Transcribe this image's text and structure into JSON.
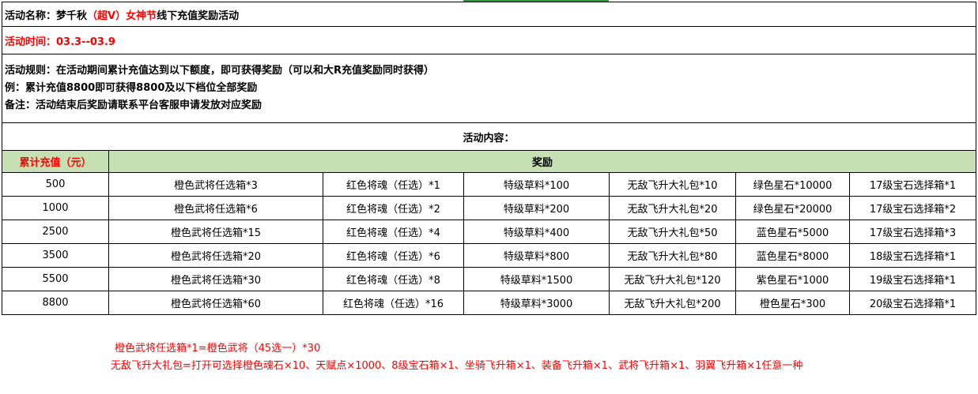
{
  "title": {
    "prefix": "活动名称：梦千秋",
    "highlight": "（超V）女神节",
    "suffix": "线下充值奖励活动"
  },
  "time": {
    "label": "活动时间：",
    "value": "03.3--03.9"
  },
  "rules": {
    "line1": "活动规则：在活动期间累计充值达到以下额度，即可获得奖励（可以和大R充值奖励同时获得）",
    "line2": "例：累计充值8800即可获得8800及以下档位全部奖励",
    "line3": "备注：活动结束后奖励请联系平台客服申请发放对应奖励"
  },
  "content_heading": "活动内容：",
  "table": {
    "header_amount": "累计充值（元）",
    "header_reward": "奖励",
    "rows": [
      {
        "amount": "500",
        "r1": "橙色武将任选箱*3",
        "r2": "红色将魂（任选）*1",
        "r3": "特级草料*100",
        "r4": "无敌飞升大礼包*10",
        "r5": "绿色星石*10000",
        "r6": "17级宝石选择箱*1"
      },
      {
        "amount": "1000",
        "r1": "橙色武将任选箱*6",
        "r2": "红色将魂（任选）*2",
        "r3": "特级草料*200",
        "r4": "无敌飞升大礼包*20",
        "r5": "绿色星石*20000",
        "r6": "17级宝石选择箱*2"
      },
      {
        "amount": "2500",
        "r1": "橙色武将任选箱*15",
        "r2": "红色将魂（任选）*4",
        "r3": "特级草料*400",
        "r4": "无敌飞升大礼包*50",
        "r5": "蓝色星石*5000",
        "r6": "17级宝石选择箱*3"
      },
      {
        "amount": "3500",
        "r1": "橙色武将任选箱*20",
        "r2": "红色将魂（任选）*6",
        "r3": "特级草料*800",
        "r4": "无敌飞升大礼包*80",
        "r5": "蓝色星石*8000",
        "r6": "18级宝石选择箱*1"
      },
      {
        "amount": "5500",
        "r1": "橙色武将任选箱*30",
        "r2": "红色将魂（任选）*8",
        "r3": "特级草料*1500",
        "r4": "无敌飞升大礼包*120",
        "r5": "紫色星石*1000",
        "r6": "19级宝石选择箱*1"
      },
      {
        "amount": "8800",
        "r1": "橙色武将任选箱*60",
        "r2": "红色将魂（任选）*16",
        "r3": "特级草料*3000",
        "r4": "无敌飞升大礼包*200",
        "r5": "橙色星石*300",
        "r6": "20级宝石选择箱*1"
      }
    ]
  },
  "notes": {
    "line1": "橙色武将任选箱*1=橙色武将（45选一）*30",
    "line2": "无敌飞升大礼包=打开可选择橙色魂石×10、天赋点×1000、8级宝石箱×1、坐骑飞升箱×1、装备飞升箱×1、武将飞升箱×1、羽翼飞升箱×1任意一种"
  },
  "colors": {
    "header_bg": "#c6e0b4",
    "accent_red": "#ff0000"
  }
}
